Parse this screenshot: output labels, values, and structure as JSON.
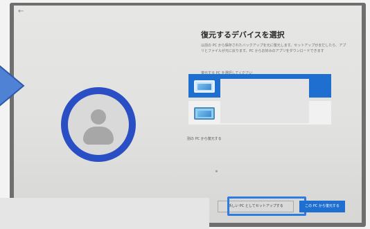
{
  "screen": {
    "back_glyph": "←",
    "title": "復元するデバイスを選択",
    "description": "以前の PC から保存されたバックアップを元に復元します。セットアップがまだしたら、アプリとファイルが元に戻ります。PC からお好みのアプリをダウンロードできます",
    "list_label": "復元する PC を選択してください",
    "devices": [
      {
        "name": "",
        "selected": true
      },
      {
        "name": "",
        "selected": false
      }
    ],
    "other_pc_link": "別の PC から復元する",
    "secondary_button": "新しい PC としてセットアップする",
    "primary_button": "この PC から復元する"
  },
  "overlay": {
    "callout_icon": "arrow-right-icon",
    "callout_color": "#4f82d4",
    "highlight_color": "#2f7be0"
  },
  "colors": {
    "accent": "#1f6fd0",
    "avatar_ring": "#2a4fc4"
  }
}
